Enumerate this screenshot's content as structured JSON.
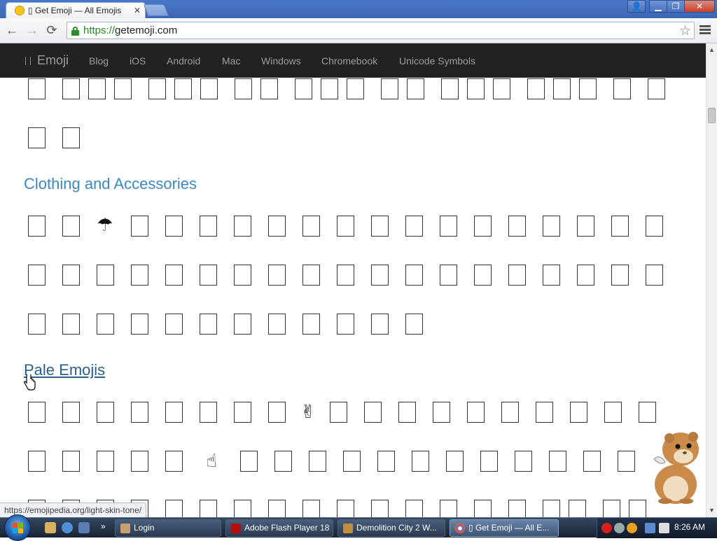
{
  "browser": {
    "tab_title": "▯ Get Emoji — All Emojis",
    "tab_close": "✕",
    "url_scheme": "https://",
    "url_host": "getemoji.com",
    "window_buttons": {
      "user": "👤",
      "minimize": "▁",
      "maximize": "❐",
      "close": "✕"
    },
    "nav": {
      "back": "←",
      "forward": "→",
      "reload": "⟳",
      "star": "☆"
    }
  },
  "site_nav": {
    "brand": "Emoji",
    "links": [
      "Blog",
      "iOS",
      "Android",
      "Mac",
      "Windows",
      "Chromebook",
      "Unicode Symbols"
    ]
  },
  "sections": {
    "clothing": "Clothing and Accessories",
    "pale": "Pale Emojis"
  },
  "emoji_glyphs": {
    "umbrella": "☂",
    "victory": "✌",
    "point_up": "☝"
  },
  "status_url": "https://emojipedia.org/light-skin-tone/",
  "taskbar": {
    "tasks": [
      "Login",
      "Adobe Flash Player 18",
      "Demolition City 2 W...",
      "▯ Get Emoji — All E..."
    ],
    "clock": "8:26 AM"
  },
  "colors": {
    "navbar_bg": "#222222",
    "section_heading": "#3d88c0",
    "link_heading": "#2a5f8d",
    "titlebar": "#3b66b4",
    "secure_green": "#1f8b1f"
  },
  "icons": [
    "lock-icon",
    "star-icon",
    "menu-icon",
    "umbrella-icon",
    "victory-hand-icon",
    "pointing-up-icon",
    "hamster-mascot",
    "hand-cursor-icon"
  ]
}
